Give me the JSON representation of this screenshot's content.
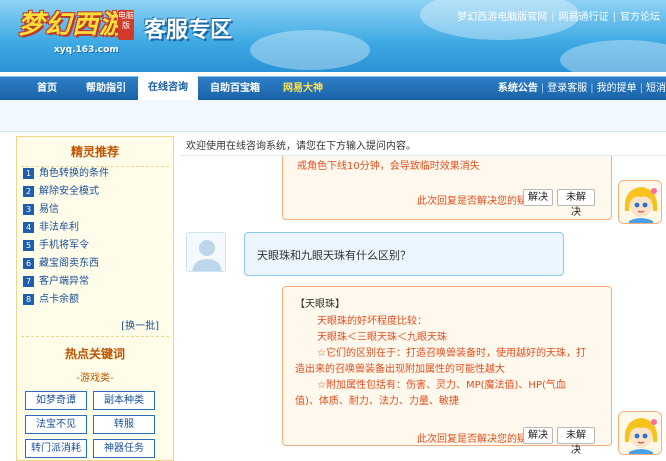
{
  "header": {
    "logo_text": "梦幻西游",
    "logo_tag": "电脑版",
    "logo_url": "xyq.163.com",
    "site_title": "客服专区",
    "links": [
      "梦幻西游电脑版官网",
      "网易通行证",
      "官方论坛"
    ]
  },
  "nav": {
    "tabs": [
      {
        "label": "首页"
      },
      {
        "label": "帮助指引"
      },
      {
        "label": "在线咨询"
      },
      {
        "label": "自助百宝箱"
      },
      {
        "label": "网易大神"
      }
    ],
    "right_links": [
      "系统公告",
      "登录客服",
      "我的提单",
      "短消"
    ]
  },
  "sidebar": {
    "title": "精灵推荐",
    "items": [
      {
        "num": "1",
        "label": "角色转换的条件"
      },
      {
        "num": "2",
        "label": "解除安全模式"
      },
      {
        "num": "3",
        "label": "易信"
      },
      {
        "num": "4",
        "label": "非法牟利"
      },
      {
        "num": "5",
        "label": "手机将军令"
      },
      {
        "num": "6",
        "label": "藏宝阁卖东西"
      },
      {
        "num": "7",
        "label": "客户端异常"
      },
      {
        "num": "8",
        "label": "点卡余额"
      }
    ],
    "change_batch": "[换一批]",
    "hot_title": "热点关键词",
    "game_category": "-游戏类-",
    "keywords": [
      "如梦奇谭",
      "副本种类",
      "法宝不见",
      "转服",
      "转门派消耗",
      "神器任务"
    ]
  },
  "main": {
    "intro": "欢迎使用在线咨询系统，请您在下方输入提问内容。",
    "answer1": {
      "text": "戒角色下线10分钟，会导致临时效果消失",
      "prompt": "此次回复是否解决您的疑问：",
      "solved": "解决",
      "unsolved": "未解决"
    },
    "question": {
      "text": "天眼珠和九眼天珠有什么区别？"
    },
    "answer2": {
      "lines": [
        "【天眼珠】",
        "天眼珠的好坏程度比较：",
        "天眼珠＜三眼天珠＜九眼天珠",
        "☆它们的区别在于：打造召唤兽装备时，使用越好的天珠，打",
        "造出来的召唤兽装备出现附加属性的可能性越大",
        "☆附加属性包括有：伤害、灵力、MP(魔法值)、HP(气血",
        "值)、体质、耐力、法力、力量、敏捷"
      ],
      "prompt": "此次回复是否解决您的疑问：",
      "solved": "解决",
      "unsolved": "未解决"
    }
  },
  "icons": {
    "user_avatar": "user-silhouette-icon",
    "kefu_avatar": "service-girl-icon"
  },
  "colors": {
    "nav_bg": "#1b62a8",
    "answer_text": "#e34d1f",
    "sidebar_bg": "#fffde9"
  }
}
